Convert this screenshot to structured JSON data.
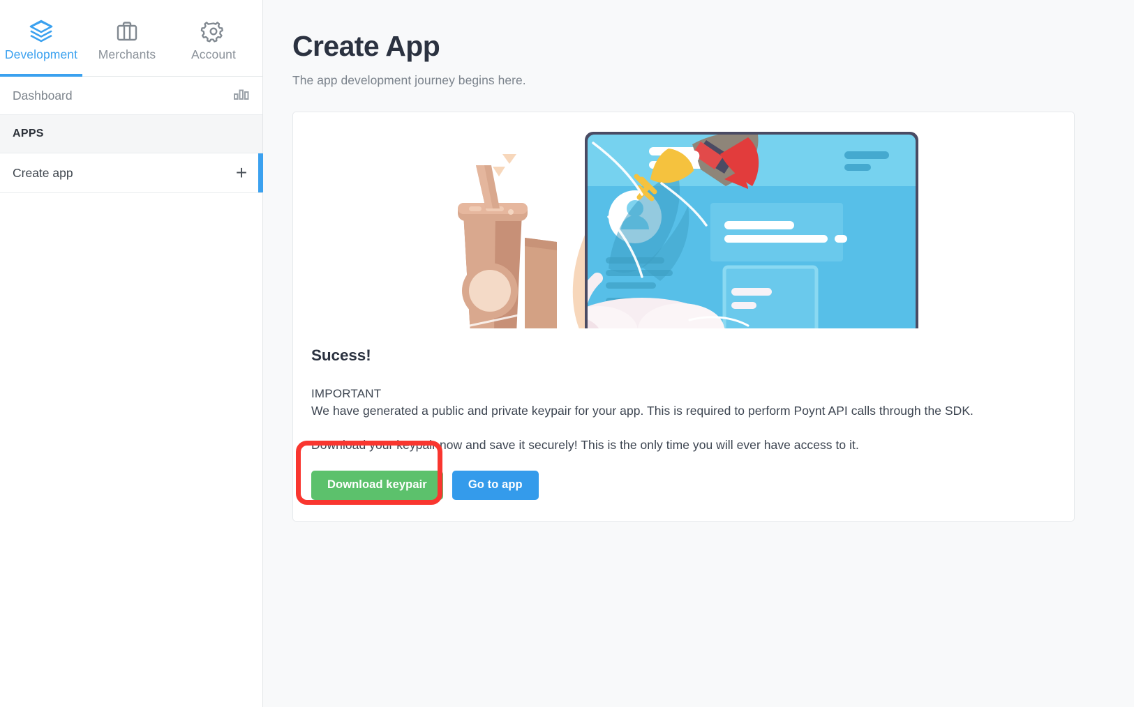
{
  "nav": {
    "tabs": [
      {
        "label": "Development",
        "icon": "layers-icon",
        "active": true
      },
      {
        "label": "Merchants",
        "icon": "briefcase-icon",
        "active": false
      },
      {
        "label": "Account",
        "icon": "gear-icon",
        "active": false
      }
    ]
  },
  "sidebar": {
    "rows": [
      {
        "label": "Dashboard",
        "icon": "bar-chart-icon"
      },
      {
        "label": "APPS"
      },
      {
        "label": "Create app",
        "icon": "plus-icon"
      }
    ]
  },
  "main": {
    "title": "Create App",
    "subtitle": "The app development journey begins here."
  },
  "card": {
    "illustration_name": "rocket-launch-tablet-illustration",
    "success_heading": "Sucess!",
    "important_label": "IMPORTANT",
    "paragraph_1": "We have generated a public and private keypair for your app. This is required to perform Poynt API calls through the SDK.",
    "paragraph_2": "Download your keypair now and save it securely! This is the only time you will ever have access to it.",
    "buttons": {
      "download": "Download keypair",
      "goto": "Go to app"
    }
  },
  "colors": {
    "accent_blue": "#3ba1ef",
    "button_green": "#5cc16c",
    "button_blue": "#349beb",
    "annotation_red": "#f9362f",
    "page_bg": "#f8f9fa",
    "text_dark": "#2b3240",
    "text_muted": "#7b838c"
  }
}
